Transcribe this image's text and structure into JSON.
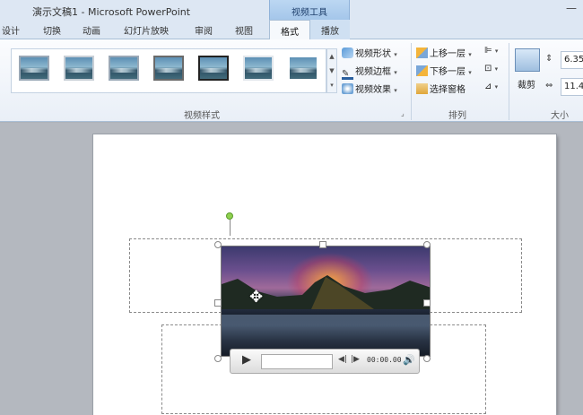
{
  "window": {
    "title": "演示文稿1 - Microsoft PowerPoint",
    "context_group": "视频工具",
    "minimize_glyph": "—"
  },
  "tabs": {
    "design": "设计",
    "transitions": "切换",
    "animations": "动画",
    "slideshow": "幻灯片放映",
    "review": "审阅",
    "view": "视图",
    "format": "格式",
    "playback": "播放"
  },
  "ribbon": {
    "video_styles": {
      "group_label": "视频样式",
      "gallery_count": 7,
      "shape": "视频形状",
      "border": "视频边框",
      "effects": "视频效果"
    },
    "arrange": {
      "group_label": "排列",
      "bring_forward": "上移一层",
      "send_backward": "下移一层",
      "selection_pane": "选择窗格"
    },
    "size": {
      "group_label": "大小",
      "crop": "裁剪",
      "height": "6.35",
      "width": "11.4"
    }
  },
  "player": {
    "time": "00:00.00"
  },
  "icons": {
    "play": "play-icon",
    "step_back": "step-back-icon",
    "step_forward": "step-forward-icon",
    "volume": "volume-icon",
    "move_cursor": "move-cursor-icon"
  },
  "colors": {
    "ribbon_bg": "#e9eff7",
    "tab_bar": "#dde7f3",
    "workspace": "#b4b8bf",
    "rotation_handle": "#8fd14f"
  }
}
